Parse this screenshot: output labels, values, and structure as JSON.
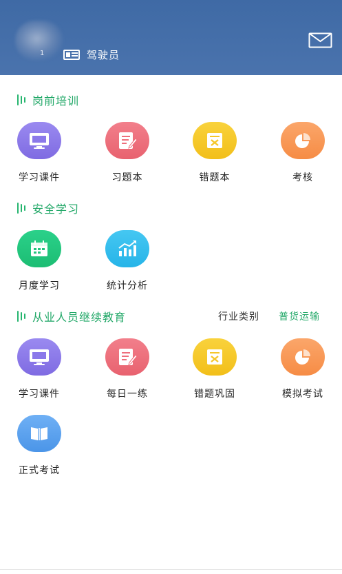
{
  "header": {
    "avatar_number": "1",
    "role": "驾驶员",
    "colors": {
      "background": "#4a73ad"
    }
  },
  "sections": {
    "pre_job": {
      "title": "岗前培训",
      "items": [
        {
          "label": "学习课件",
          "icon": "monitor-icon",
          "color": "#8b79ea"
        },
        {
          "label": "习题本",
          "icon": "notebook-pen-icon",
          "color": "#ee6f7c"
        },
        {
          "label": "错题本",
          "icon": "wrong-book-icon",
          "color": "#f5c629"
        },
        {
          "label": "考核",
          "icon": "pie-chart-icon",
          "color": "#f99752"
        }
      ]
    },
    "safety": {
      "title": "安全学习",
      "items": [
        {
          "label": "月度学习",
          "icon": "calendar-icon",
          "color": "#22c57d"
        },
        {
          "label": "统计分析",
          "icon": "bar-chart-trend-icon",
          "color": "#33bced"
        }
      ]
    },
    "continuing": {
      "title": "从业人员继续教育",
      "category_label": "行业类别",
      "category_value": "普货运输",
      "items": [
        {
          "label": "学习课件",
          "icon": "monitor-icon",
          "color": "#8b79ea"
        },
        {
          "label": "每日一练",
          "icon": "notebook-pen-icon",
          "color": "#ee6f7c"
        },
        {
          "label": "错题巩固",
          "icon": "wrong-book-icon",
          "color": "#f5c629"
        },
        {
          "label": "模拟考试",
          "icon": "pie-chart-icon",
          "color": "#f99752"
        },
        {
          "label": "正式考试",
          "icon": "open-book-icon",
          "color": "#5ca2ee"
        }
      ]
    }
  },
  "accent_color": "#22a868"
}
